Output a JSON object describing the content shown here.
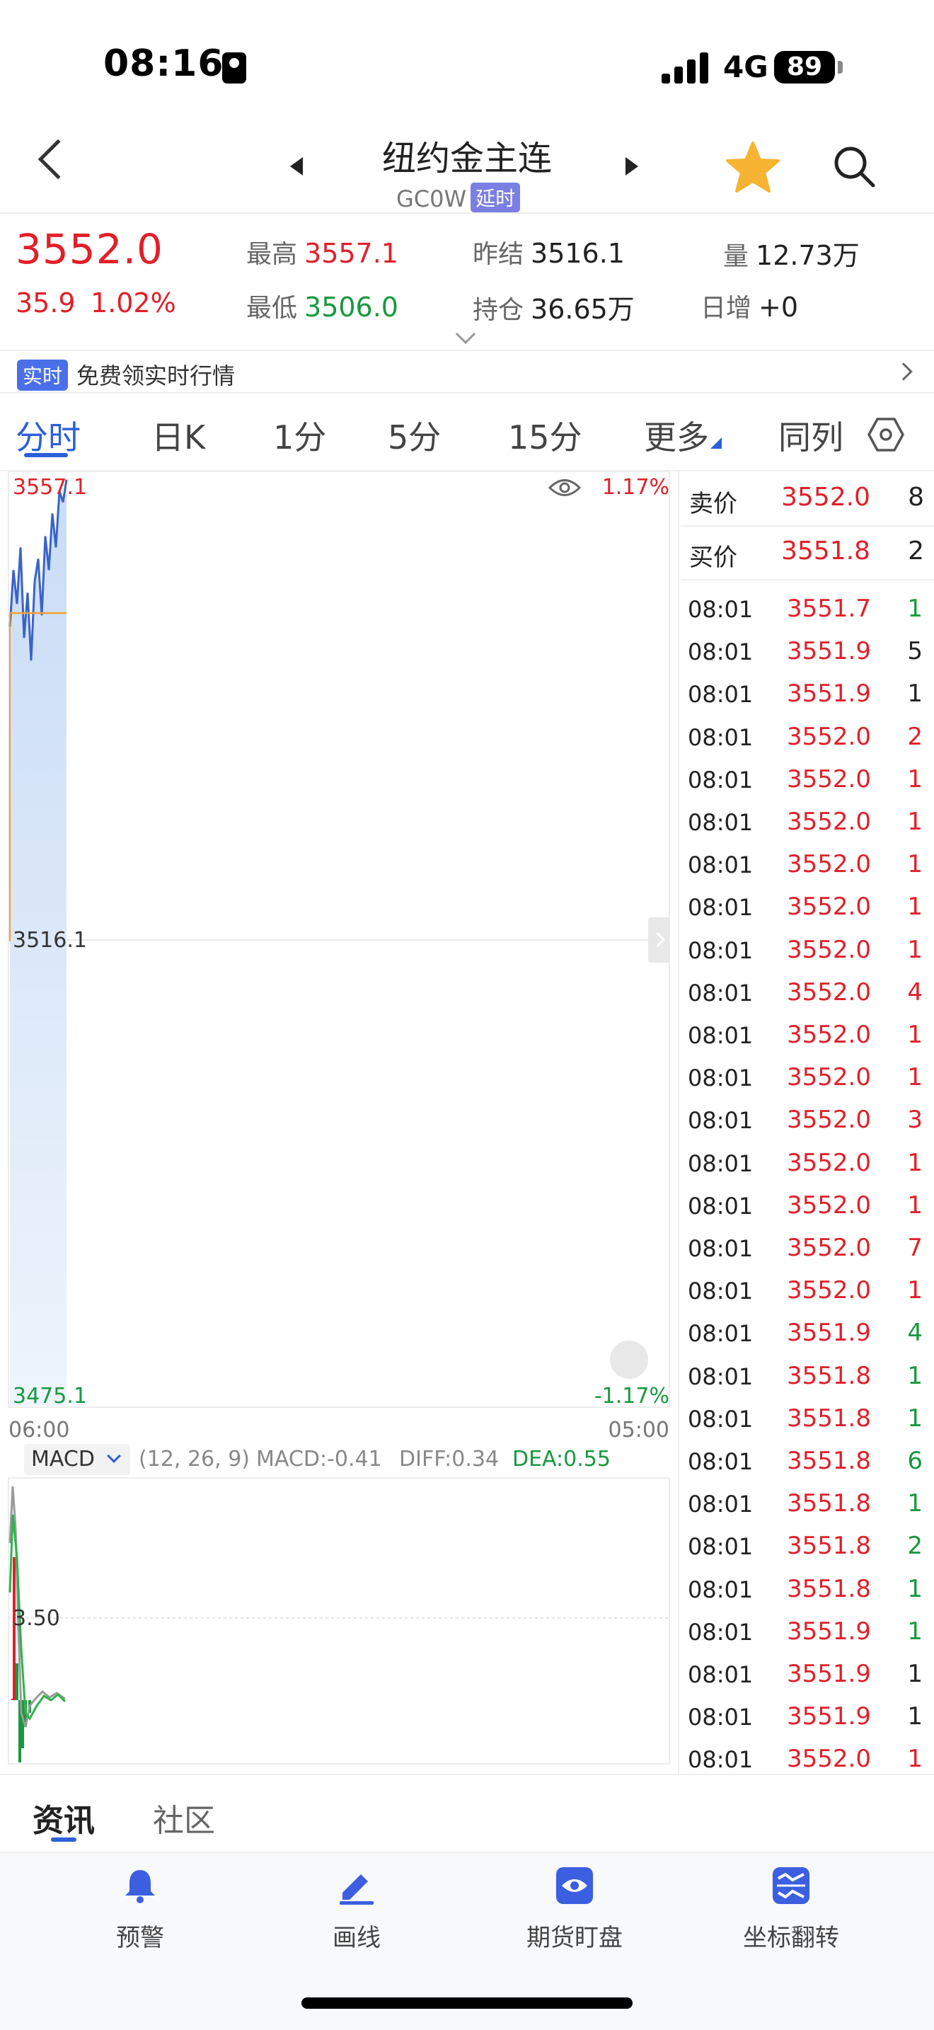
{
  "status_bar": {
    "time": "08:16",
    "network": "4G",
    "battery": "89"
  },
  "header": {
    "title": "纽约金主连",
    "code": "GC0W",
    "delay_badge": "延时"
  },
  "quote": {
    "last": "3552.0",
    "change": "35.9",
    "change_pct": "1.02%",
    "high_label": "最高",
    "high": "3557.1",
    "low_label": "最低",
    "low": "3506.0",
    "prev_settle_label": "昨结",
    "prev_settle": "3516.1",
    "open_interest_label": "持仓",
    "open_interest": "36.65万",
    "volume_label": "量",
    "volume": "12.73万",
    "daily_add_label": "日增",
    "daily_add": "+0"
  },
  "banner": {
    "badge": "实时",
    "text": "免费领实时行情"
  },
  "period_tabs": [
    "分时",
    "日K",
    "1分",
    "5分",
    "15分",
    "更多",
    "同列"
  ],
  "chart": {
    "y_top": "3557.1",
    "y_mid": "3516.1",
    "y_bottom": "3475.1",
    "pct_top": "1.17%",
    "pct_bottom": "-1.17%",
    "x_start": "06:00",
    "x_end": "05:00",
    "macd_indicator": "MACD",
    "macd_params": "(12, 26, 9)",
    "macd_value": "MACD:-0.41",
    "diff_value": "DIFF:0.34",
    "dea_value": "DEA:0.55",
    "macd_axis_label": "3.50",
    "colors": {
      "up": "#e0202a",
      "down": "#17993f",
      "price_line": "#3a63c9",
      "avg_line": "#f0a030"
    }
  },
  "order_book": {
    "ask": {
      "label": "卖价",
      "price": "3552.0",
      "volume": "8"
    },
    "bid": {
      "label": "买价",
      "price": "3551.8",
      "volume": "2"
    }
  },
  "ticks": [
    {
      "time": "08:01",
      "price": "3551.7",
      "vol": "1",
      "dir": "down"
    },
    {
      "time": "08:01",
      "price": "3551.9",
      "vol": "5",
      "dir": "neutral"
    },
    {
      "time": "08:01",
      "price": "3551.9",
      "vol": "1",
      "dir": "neutral"
    },
    {
      "time": "08:01",
      "price": "3552.0",
      "vol": "2",
      "dir": "up"
    },
    {
      "time": "08:01",
      "price": "3552.0",
      "vol": "1",
      "dir": "up"
    },
    {
      "time": "08:01",
      "price": "3552.0",
      "vol": "1",
      "dir": "up"
    },
    {
      "time": "08:01",
      "price": "3552.0",
      "vol": "1",
      "dir": "up"
    },
    {
      "time": "08:01",
      "price": "3552.0",
      "vol": "1",
      "dir": "up"
    },
    {
      "time": "08:01",
      "price": "3552.0",
      "vol": "1",
      "dir": "up"
    },
    {
      "time": "08:01",
      "price": "3552.0",
      "vol": "4",
      "dir": "up"
    },
    {
      "time": "08:01",
      "price": "3552.0",
      "vol": "1",
      "dir": "up"
    },
    {
      "time": "08:01",
      "price": "3552.0",
      "vol": "1",
      "dir": "up"
    },
    {
      "time": "08:01",
      "price": "3552.0",
      "vol": "3",
      "dir": "up"
    },
    {
      "time": "08:01",
      "price": "3552.0",
      "vol": "1",
      "dir": "up"
    },
    {
      "time": "08:01",
      "price": "3552.0",
      "vol": "1",
      "dir": "up"
    },
    {
      "time": "08:01",
      "price": "3552.0",
      "vol": "7",
      "dir": "up"
    },
    {
      "time": "08:01",
      "price": "3552.0",
      "vol": "1",
      "dir": "up"
    },
    {
      "time": "08:01",
      "price": "3551.9",
      "vol": "4",
      "dir": "down"
    },
    {
      "time": "08:01",
      "price": "3551.8",
      "vol": "1",
      "dir": "down"
    },
    {
      "time": "08:01",
      "price": "3551.8",
      "vol": "1",
      "dir": "down"
    },
    {
      "time": "08:01",
      "price": "3551.8",
      "vol": "6",
      "dir": "down"
    },
    {
      "time": "08:01",
      "price": "3551.8",
      "vol": "1",
      "dir": "down"
    },
    {
      "time": "08:01",
      "price": "3551.8",
      "vol": "2",
      "dir": "down"
    },
    {
      "time": "08:01",
      "price": "3551.8",
      "vol": "1",
      "dir": "down"
    },
    {
      "time": "08:01",
      "price": "3551.9",
      "vol": "1",
      "dir": "down"
    },
    {
      "time": "08:01",
      "price": "3551.9",
      "vol": "1",
      "dir": "neutral"
    },
    {
      "time": "08:01",
      "price": "3551.9",
      "vol": "1",
      "dir": "neutral"
    },
    {
      "time": "08:01",
      "price": "3552.0",
      "vol": "1",
      "dir": "up"
    }
  ],
  "bottom_tabs": [
    "资讯",
    "社区"
  ],
  "toolbar": [
    {
      "label": "预警",
      "icon": "bell-icon"
    },
    {
      "label": "画线",
      "icon": "pen-icon"
    },
    {
      "label": "期货盯盘",
      "icon": "eye-icon"
    },
    {
      "label": "坐标翻转",
      "icon": "flip-axis-icon"
    }
  ]
}
